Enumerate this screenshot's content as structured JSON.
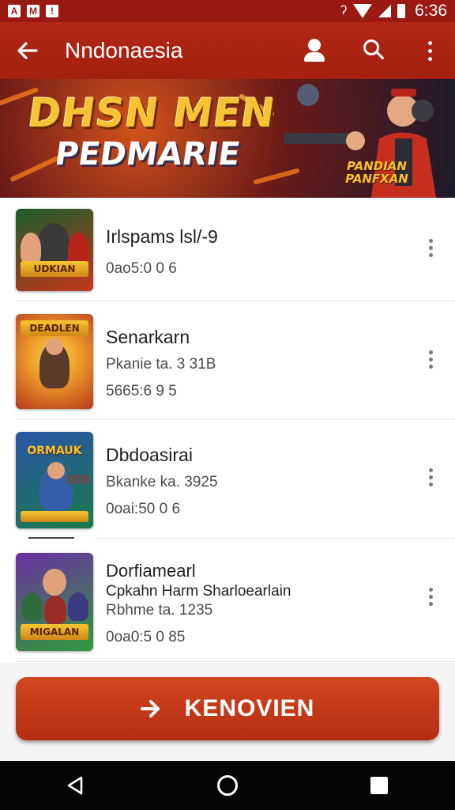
{
  "status_bar": {
    "time": "6:36",
    "left_icons": [
      "A",
      "M",
      "!"
    ],
    "right_symbol": "ʔ"
  },
  "app_bar": {
    "title": "Nndonaesia",
    "back_icon": "arrow-left-icon",
    "actions": [
      "avatar-icon",
      "search-icon",
      "more-vert-icon"
    ]
  },
  "banner": {
    "title": "DHSN MEN",
    "subtitle": "PEDMARIE",
    "tagline": "PANDIAN PANFXAN"
  },
  "games": [
    {
      "thumb_text": "UDKIAN",
      "thumb_colors": [
        "#1b5e2b",
        "#c3361a"
      ],
      "title": "Irlspams lsl/-9",
      "lines": [
        "0ao5:0 0 6"
      ]
    },
    {
      "thumb_text": "DEADLEN",
      "thumb_colors": [
        "#f0a22b",
        "#b8381b"
      ],
      "title": "Senarkarn",
      "lines": [
        "Pkanie ta. 3 31B",
        "5665:6 9 5"
      ]
    },
    {
      "thumb_text": "ORMAUK",
      "thumb_colors": [
        "#2a55a8",
        "#1b7a4a"
      ],
      "title": "Dbdoasirai",
      "lines": [
        "Bkanke ka. 3925",
        "0oai:50 0 6"
      ]
    },
    {
      "thumb_text": "MIGALAN",
      "thumb_colors": [
        "#6b2fa2",
        "#2f9a3a"
      ],
      "title": "Dorfiamearl",
      "lines": [
        "Cpkahn Harm Sharloearlain",
        "Rbhme ta. 1235",
        "0oa0:5 0 85"
      ]
    }
  ],
  "cta": {
    "label": "KENOVIEN",
    "icon": "arrow-right-icon"
  },
  "nav": [
    "back-icon",
    "home-icon",
    "recents-icon"
  ]
}
